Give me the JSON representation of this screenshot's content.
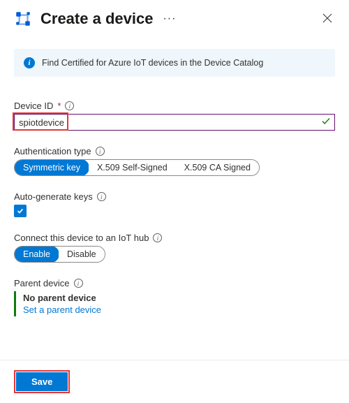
{
  "header": {
    "title": "Create a device"
  },
  "info": {
    "text": "Find Certified for Azure IoT devices in the Device Catalog"
  },
  "deviceId": {
    "label": "Device ID",
    "value": "spiotdevice"
  },
  "authType": {
    "label": "Authentication type",
    "options": {
      "symmetric": "Symmetric key",
      "selfSigned": "X.509 Self-Signed",
      "caSigned": "X.509 CA Signed"
    }
  },
  "autoGen": {
    "label": "Auto-generate keys",
    "checked": true
  },
  "connectHub": {
    "label": "Connect this device to an IoT hub",
    "options": {
      "enable": "Enable",
      "disable": "Disable"
    }
  },
  "parent": {
    "label": "Parent device",
    "noneText": "No parent device",
    "linkText": "Set a parent device"
  },
  "footer": {
    "save": "Save"
  }
}
